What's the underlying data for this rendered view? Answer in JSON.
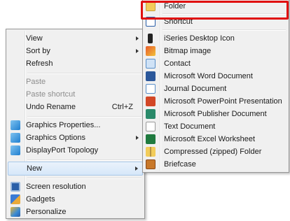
{
  "context_menu": {
    "items": [
      {
        "label": "View",
        "submenu": true
      },
      {
        "label": "Sort by",
        "submenu": true
      },
      {
        "label": "Refresh"
      },
      {
        "label": "Paste",
        "disabled": true
      },
      {
        "label": "Paste shortcut",
        "disabled": true
      },
      {
        "label": "Undo Rename",
        "shortcut": "Ctrl+Z"
      },
      {
        "label": "Graphics Properties...",
        "icon": "intel-graphics-icon"
      },
      {
        "label": "Graphics Options",
        "icon": "intel-graphics-icon",
        "submenu": true
      },
      {
        "label": "DisplayPort Topology",
        "icon": "intel-graphics-icon"
      },
      {
        "label": "New",
        "submenu": true,
        "highlighted": true
      },
      {
        "label": "Screen resolution",
        "icon": "monitor-icon"
      },
      {
        "label": "Gadgets",
        "icon": "gadgets-icon"
      },
      {
        "label": "Personalize",
        "icon": "personalize-icon"
      }
    ]
  },
  "new_submenu": {
    "items": [
      {
        "label": "Folder",
        "icon": "folder-icon"
      },
      {
        "label": "Shortcut",
        "icon": "shortcut-icon"
      },
      {
        "label": "iSeries Desktop Icon",
        "icon": "iseries-icon"
      },
      {
        "label": "Bitmap image",
        "icon": "bitmap-icon"
      },
      {
        "label": "Contact",
        "icon": "contact-icon"
      },
      {
        "label": "Microsoft Word Document",
        "icon": "word-icon"
      },
      {
        "label": "Journal Document",
        "icon": "journal-icon"
      },
      {
        "label": "Microsoft PowerPoint Presentation",
        "icon": "powerpoint-icon"
      },
      {
        "label": "Microsoft Publisher Document",
        "icon": "publisher-icon"
      },
      {
        "label": "Text Document",
        "icon": "text-document-icon"
      },
      {
        "label": "Microsoft Excel Worksheet",
        "icon": "excel-icon"
      },
      {
        "label": "Compressed (zipped) Folder",
        "icon": "zip-folder-icon"
      },
      {
        "label": "Briefcase",
        "icon": "briefcase-icon"
      }
    ]
  },
  "colors": {
    "menu_bg": "#f0f0f0",
    "highlight_border": "#e01010",
    "disabled_text": "#8d8d8d"
  }
}
